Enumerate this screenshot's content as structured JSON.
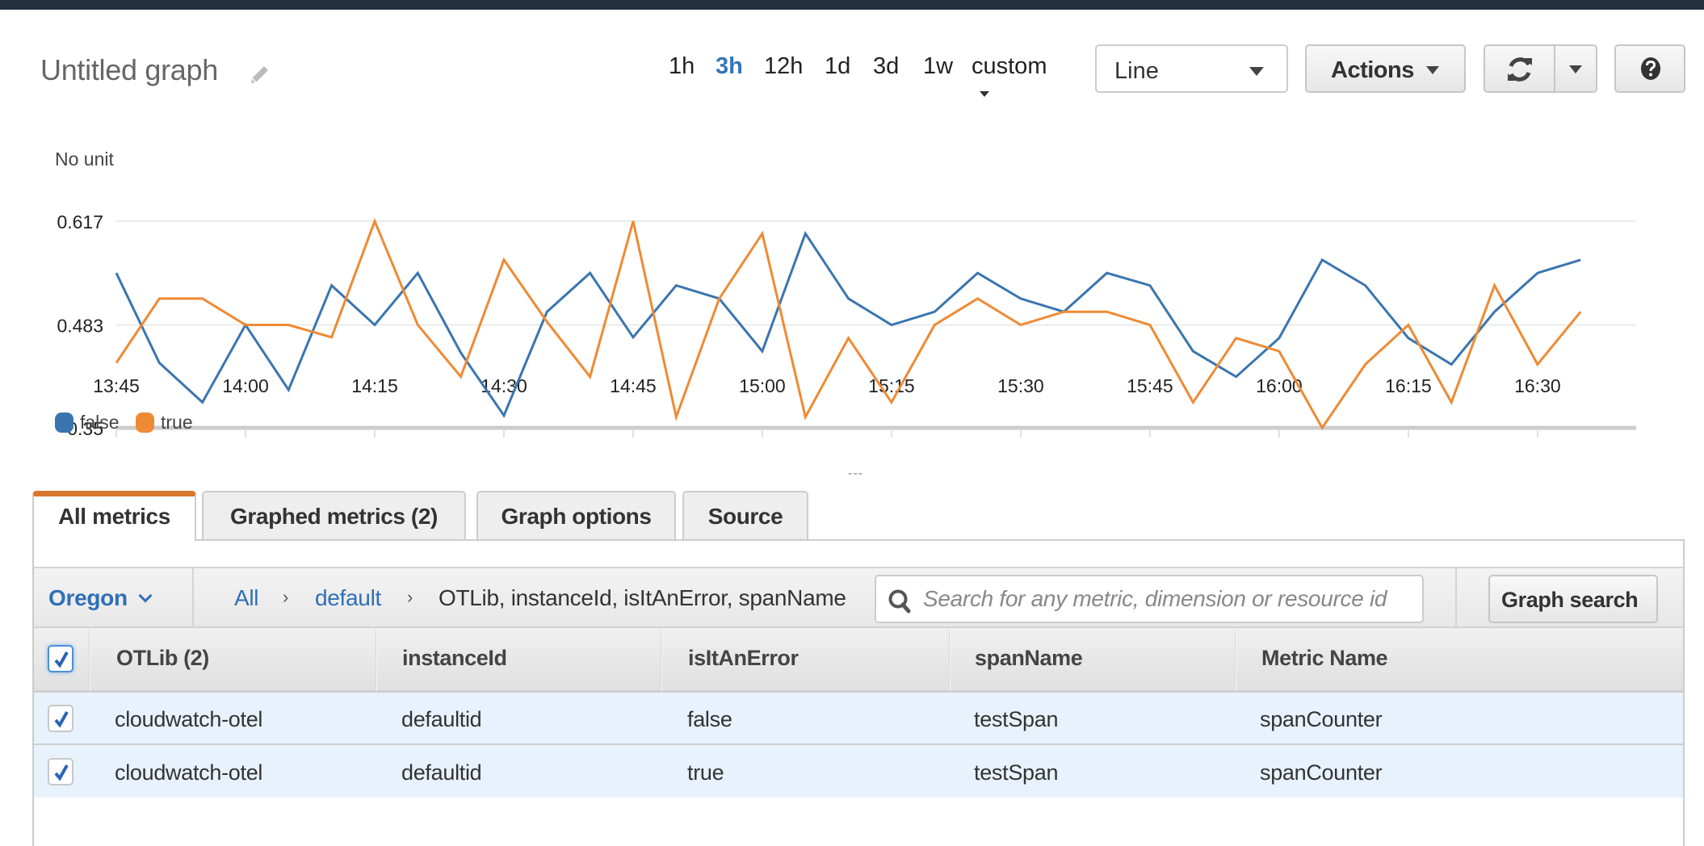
{
  "header": {
    "title": "Untitled graph",
    "edit_icon": "pencil-icon",
    "time_ranges": [
      {
        "label": "1h",
        "active": false
      },
      {
        "label": "3h",
        "active": true
      },
      {
        "label": "12h",
        "active": false
      },
      {
        "label": "1d",
        "active": false
      },
      {
        "label": "3d",
        "active": false
      },
      {
        "label": "1w",
        "active": false
      },
      {
        "label": "custom",
        "active": false
      }
    ],
    "chart_type_select": "Line",
    "actions_label": "Actions",
    "refresh_icon": "refresh-icon",
    "help_icon": "help-icon"
  },
  "colors": {
    "accent_tab": "#d9782d",
    "link": "#2f6fb7",
    "series_false": "#3a75b0",
    "series_true": "#ef8a34",
    "row_selected": "#e8f2fc"
  },
  "chart_data": {
    "type": "line",
    "title": "Untitled graph",
    "ylabel": "No unit",
    "xlabel": "",
    "ylim": [
      0.35,
      0.617
    ],
    "yticks": [
      0.35,
      0.483,
      0.617
    ],
    "ytick_labels": [
      "0.35",
      "0.483",
      "0.617"
    ],
    "x": [
      "13:45",
      "13:50",
      "13:55",
      "14:00",
      "14:05",
      "14:10",
      "14:15",
      "14:20",
      "14:25",
      "14:30",
      "14:35",
      "14:40",
      "14:45",
      "14:50",
      "14:55",
      "15:00",
      "15:05",
      "15:10",
      "15:15",
      "15:20",
      "15:25",
      "15:30",
      "15:35",
      "15:40",
      "15:45",
      "15:50",
      "15:55",
      "16:00",
      "16:05",
      "16:10",
      "16:15",
      "16:20",
      "16:25",
      "16:30",
      "16:35"
    ],
    "xtick_labels": [
      "13:45",
      "14:00",
      "14:15",
      "14:30",
      "14:45",
      "15:00",
      "15:15",
      "15:30",
      "15:45",
      "16:00",
      "16:15",
      "16:30"
    ],
    "grid": true,
    "legend_position": "bottom-left",
    "series": [
      {
        "name": "false",
        "color": "#3a75b0",
        "values": [
          0.55,
          0.434,
          0.383,
          0.483,
          0.399,
          0.534,
          0.483,
          0.55,
          0.447,
          0.366,
          0.5,
          0.55,
          0.467,
          0.534,
          0.517,
          0.449,
          0.601,
          0.517,
          0.483,
          0.5,
          0.55,
          0.517,
          0.5,
          0.55,
          0.534,
          0.449,
          0.416,
          0.466,
          0.567,
          0.534,
          0.466,
          0.432,
          0.5,
          0.55,
          0.567
        ]
      },
      {
        "name": "true",
        "color": "#ef8a34",
        "values": [
          0.434,
          0.517,
          0.517,
          0.483,
          0.483,
          0.467,
          0.617,
          0.483,
          0.416,
          0.567,
          0.487,
          0.416,
          0.617,
          0.364,
          0.517,
          0.601,
          0.364,
          0.466,
          0.383,
          0.483,
          0.517,
          0.483,
          0.5,
          0.5,
          0.483,
          0.383,
          0.466,
          0.449,
          0.35,
          0.432,
          0.483,
          0.383,
          0.534,
          0.432,
          0.5
        ]
      }
    ]
  },
  "resize_handle": "---",
  "tabs": [
    {
      "label": "All metrics",
      "active": true
    },
    {
      "label": "Graphed metrics (2)",
      "active": false
    },
    {
      "label": "Graph options",
      "active": false
    },
    {
      "label": "Source",
      "active": false
    }
  ],
  "browser": {
    "region": "Oregon",
    "breadcrumb": [
      {
        "label": "All",
        "link": true
      },
      {
        "label": "default",
        "link": true
      },
      {
        "label": "OTLib, instanceId, isItAnError, spanName",
        "link": false
      }
    ],
    "search_placeholder": "Search for any metric, dimension or resource id",
    "search_value": "",
    "graph_search_label": "Graph search"
  },
  "table": {
    "select_all_checked": true,
    "columns": [
      "OTLib (2)",
      "instanceId",
      "isItAnError",
      "spanName",
      "Metric Name"
    ],
    "rows": [
      {
        "checked": true,
        "cells": [
          "cloudwatch-otel",
          "defaultid",
          "false",
          "testSpan",
          "spanCounter"
        ]
      },
      {
        "checked": true,
        "cells": [
          "cloudwatch-otel",
          "defaultid",
          "true",
          "testSpan",
          "spanCounter"
        ]
      }
    ]
  }
}
